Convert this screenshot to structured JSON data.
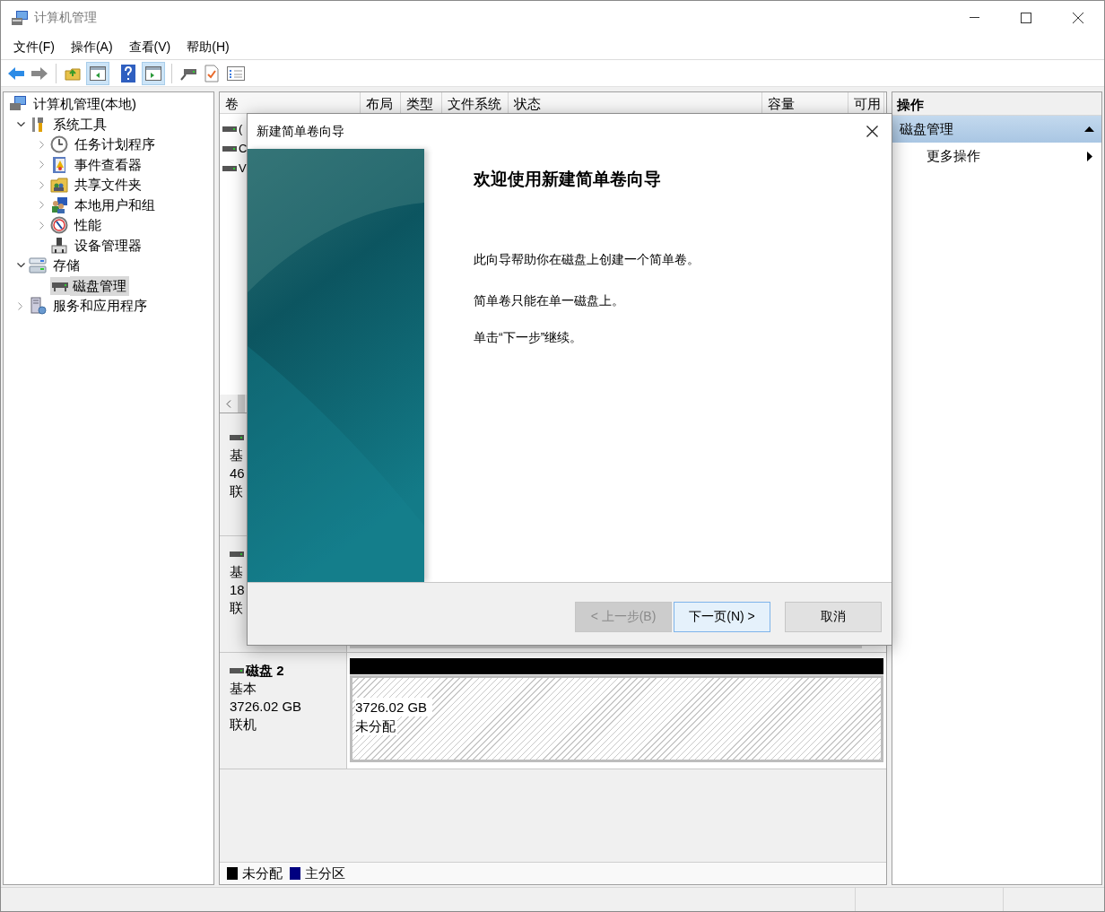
{
  "window": {
    "title": "计算机管理"
  },
  "menu": [
    "文件(F)",
    "操作(A)",
    "查看(V)",
    "帮助(H)"
  ],
  "tree": [
    {
      "label": "计算机管理(本地)",
      "selected": false,
      "children": [
        {
          "label": "系统工具",
          "expanded": true,
          "selected": false,
          "children": [
            {
              "label": "任务计划程序",
              "expanded": false,
              "selected": false
            },
            {
              "label": "事件查看器",
              "expanded": false,
              "selected": false
            },
            {
              "label": "共享文件夹",
              "expanded": false,
              "selected": false
            },
            {
              "label": "本地用户和组",
              "expanded": false,
              "selected": false
            },
            {
              "label": "性能",
              "expanded": false,
              "selected": false
            },
            {
              "label": "设备管理器",
              "selected": false
            }
          ]
        },
        {
          "label": "存储",
          "expanded": true,
          "selected": false,
          "children": [
            {
              "label": "磁盘管理",
              "selected": true
            }
          ]
        },
        {
          "label": "服务和应用程序",
          "expanded": false,
          "selected": false
        }
      ]
    }
  ],
  "volume_table": {
    "columns": [
      "卷",
      "布局",
      "类型",
      "文件系统",
      "状态",
      "容量",
      "可用"
    ],
    "rows": [
      {
        "name": "("
      },
      {
        "name": "C"
      },
      {
        "name": "V"
      }
    ]
  },
  "disks": [
    {
      "lines": [
        "基",
        "46",
        "联"
      ]
    },
    {
      "lines": [
        "基",
        "18",
        "联"
      ]
    },
    {
      "name": "磁盘 2",
      "lines": [
        "基本",
        "3726.02 GB",
        "联机"
      ],
      "partitions": [
        {
          "size": "3726.02 GB",
          "status": "未分配",
          "kind": "unallocated"
        }
      ]
    }
  ],
  "legend": [
    {
      "label": "未分配",
      "color": "#000000"
    },
    {
      "label": "主分区",
      "color": "#000080"
    }
  ],
  "actions": {
    "title": "操作",
    "sections": [
      {
        "label": "磁盘管理",
        "expanded": true,
        "items": [
          "更多操作"
        ]
      }
    ]
  },
  "dialog": {
    "title": "新建简单卷向导",
    "heading": "欢迎使用新建简单卷向导",
    "paragraphs": [
      "此向导帮助你在磁盘上创建一个简单卷。",
      "简单卷只能在单一磁盘上。",
      "单击“下一步”继续。"
    ],
    "buttons": [
      {
        "label": "< 上一步(B)",
        "disabled": true,
        "default": false
      },
      {
        "label": "下一页(N) >",
        "disabled": false,
        "default": true
      },
      {
        "label": "取消",
        "disabled": false,
        "default": false
      }
    ]
  }
}
